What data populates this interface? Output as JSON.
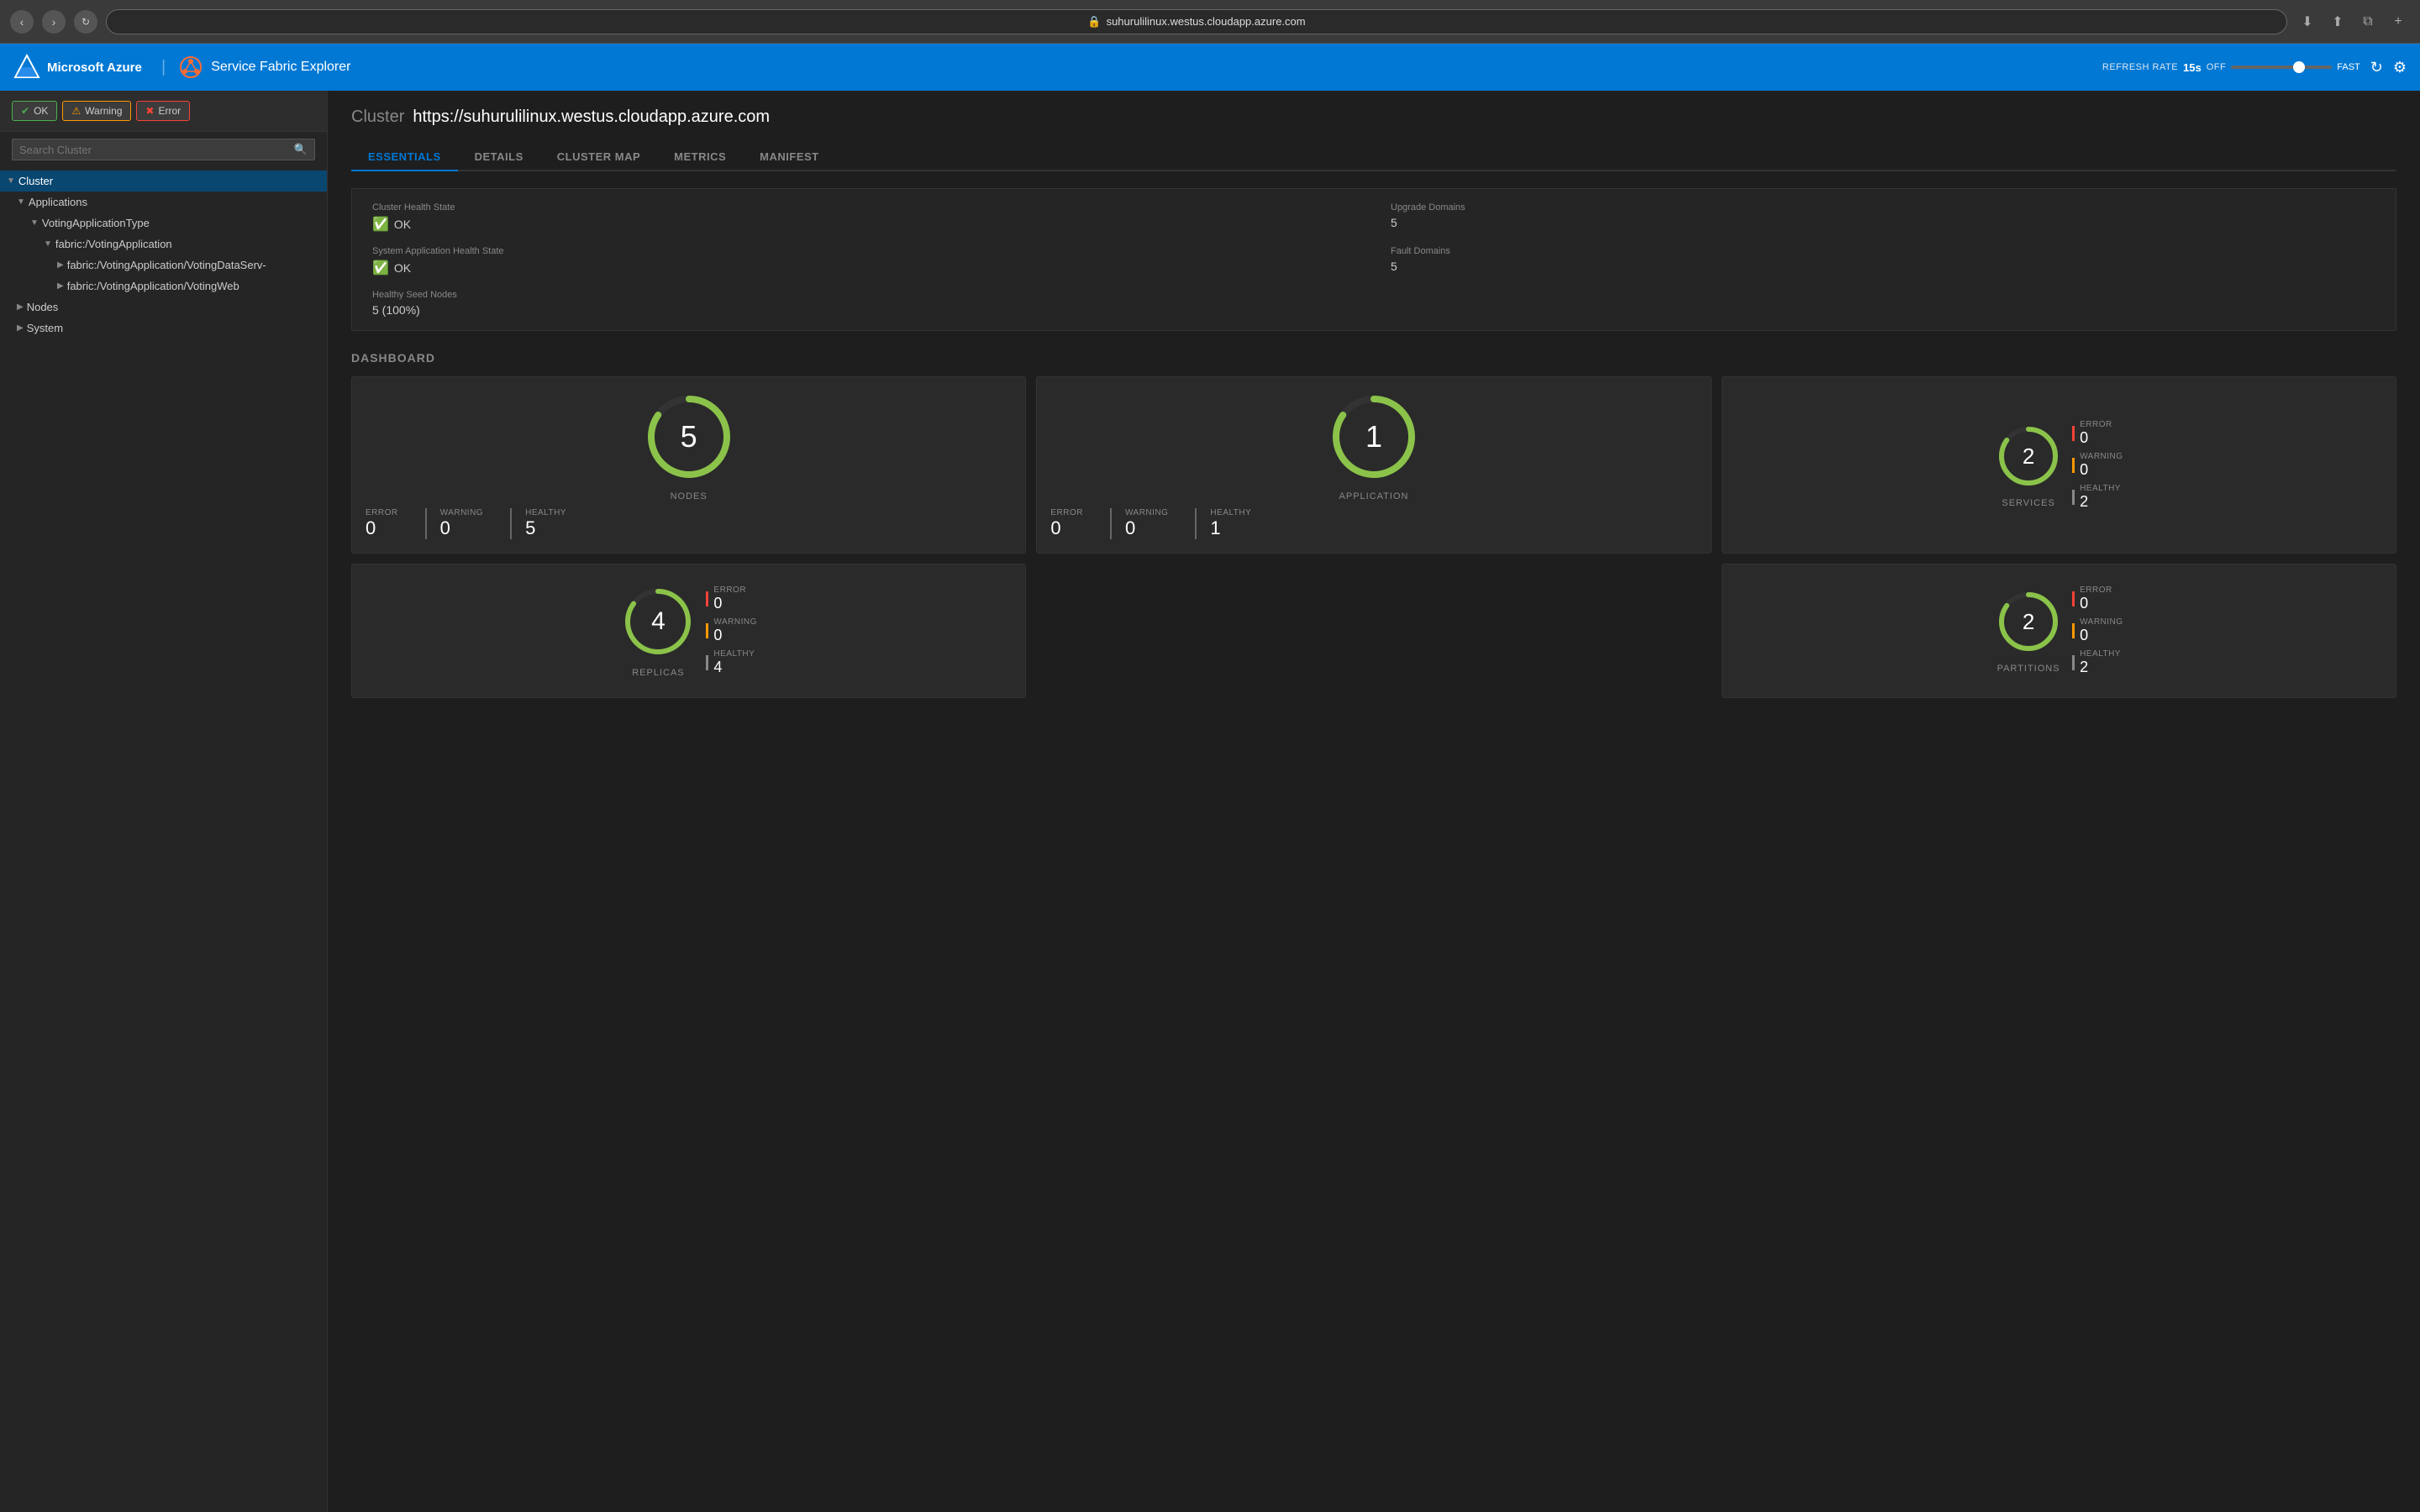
{
  "browser": {
    "url": "suhurulilinux.westus.cloudapp.azure.com",
    "url_display": "suhurulilinux.westus.cloudapp.azure.com"
  },
  "app": {
    "azure_label": "Microsoft Azure",
    "title": "Service Fabric Explorer",
    "header_right": {
      "refresh_rate_label": "REFRESH RATE",
      "refresh_value": "15s",
      "off_label": "OFF",
      "fast_label": "FAST"
    }
  },
  "sidebar": {
    "search_placeholder": "Search Cluster",
    "filters": {
      "ok": "OK",
      "warning": "Warning",
      "error": "Error"
    },
    "tree": [
      {
        "id": "cluster",
        "label": "Cluster",
        "indent": 0,
        "expanded": true,
        "active": true,
        "chevron": "▼"
      },
      {
        "id": "applications",
        "label": "Applications",
        "indent": 1,
        "expanded": true,
        "chevron": "▼"
      },
      {
        "id": "votingapptype",
        "label": "VotingApplicationType",
        "indent": 2,
        "expanded": true,
        "chevron": "▼"
      },
      {
        "id": "votingapp",
        "label": "fabric:/VotingApplication",
        "indent": 3,
        "expanded": true,
        "chevron": "▼"
      },
      {
        "id": "votingdatasrv",
        "label": "fabric:/VotingApplication/VotingDataServ-",
        "indent": 4,
        "expanded": false,
        "chevron": "▶"
      },
      {
        "id": "votingweb",
        "label": "fabric:/VotingApplication/VotingWeb",
        "indent": 4,
        "expanded": false,
        "chevron": "▶"
      },
      {
        "id": "nodes",
        "label": "Nodes",
        "indent": 1,
        "expanded": false,
        "chevron": "▶"
      },
      {
        "id": "system",
        "label": "System",
        "indent": 1,
        "expanded": false,
        "chevron": "▶"
      }
    ]
  },
  "content": {
    "cluster_label": "Cluster",
    "cluster_url": "https://suhurulilinux.westus.cloudapp.azure.com",
    "tabs": [
      "ESSENTIALS",
      "DETAILS",
      "CLUSTER MAP",
      "METRICS",
      "MANIFEST"
    ],
    "active_tab": "ESSENTIALS",
    "essentials": {
      "cluster_health_state_label": "Cluster Health State",
      "cluster_health_state_value": "OK",
      "system_app_health_state_label": "System Application Health State",
      "system_app_health_state_value": "OK",
      "healthy_seed_nodes_label": "Healthy Seed Nodes",
      "healthy_seed_nodes_value": "5 (100%)",
      "upgrade_domains_label": "Upgrade Domains",
      "upgrade_domains_value": "5",
      "fault_domains_label": "Fault Domains",
      "fault_domains_value": "5"
    },
    "dashboard": {
      "title": "DASHBOARD",
      "nodes": {
        "number": "5",
        "label": "NODES",
        "error": "0",
        "warning": "0",
        "healthy": "5",
        "arc_pct": 0.85
      },
      "application": {
        "number": "1",
        "label": "APPLICATION",
        "error": "0",
        "warning": "0",
        "healthy": "1",
        "arc_pct": 0.85
      },
      "services": {
        "number": "2",
        "label": "SERVICES",
        "error": "0",
        "warning": "0",
        "healthy": "2",
        "arc_pct": 0.85
      },
      "partitions": {
        "number": "2",
        "label": "PARTITIONS",
        "error": "0",
        "warning": "0",
        "healthy": "2",
        "arc_pct": 0.85
      },
      "replicas": {
        "number": "4",
        "label": "REPLICAS",
        "error": "0",
        "warning": "0",
        "healthy": "4",
        "arc_pct": 0.85
      }
    }
  }
}
